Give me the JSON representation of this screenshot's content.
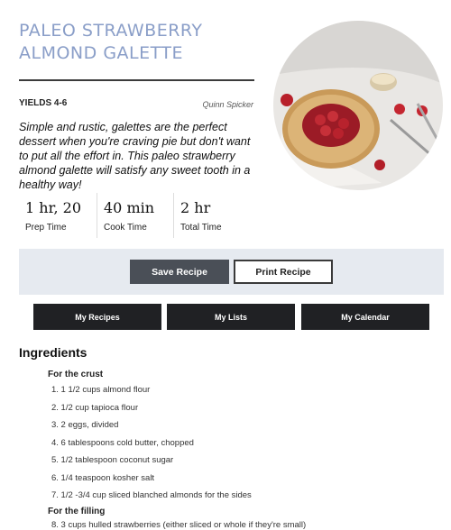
{
  "recipe": {
    "title": "PALEO STRAWBERRY ALMOND GALETTE",
    "yields": "YIELDS 4-6",
    "author": "Quinn Spicker",
    "description": "Simple and rustic, galettes are the perfect dessert when you're craving pie but don't want to put all the effort in. This paleo strawberry almond galette will satisfy any sweet tooth in a healthy way!",
    "times": [
      {
        "value": "1 hr, 20",
        "label": "Prep Time"
      },
      {
        "value": "40 min",
        "label": "Cook Time"
      },
      {
        "value": "2 hr",
        "label": "Total Time"
      }
    ]
  },
  "actions": {
    "save_label": "Save Recipe",
    "print_label": "Print Recipe"
  },
  "nav": {
    "items": [
      "My Recipes",
      "My Lists",
      "My Calendar"
    ]
  },
  "ingredients": {
    "heading": "Ingredients",
    "groups": [
      {
        "title": "For the crust",
        "items": [
          "1. 1 1/2 cups almond flour",
          "2. 1/2 cup tapioca flour",
          "3. 2 eggs, divided",
          "4. 6 tablespoons cold butter, chopped",
          "5. 1/2 tablespoon coconut sugar",
          "6. 1/4 teaspoon kosher salt",
          "7. 1/2 -3/4 cup sliced blanched almonds for the sides"
        ]
      },
      {
        "title": "For the filling",
        "items": [
          "8. 3 cups hulled strawberries (either sliced or whole if they're small)"
        ]
      }
    ]
  },
  "colors": {
    "title": "#8a9ec8",
    "band": "#e6eaf0",
    "save_button": "#4a4f57",
    "nav_button": "#202124"
  }
}
